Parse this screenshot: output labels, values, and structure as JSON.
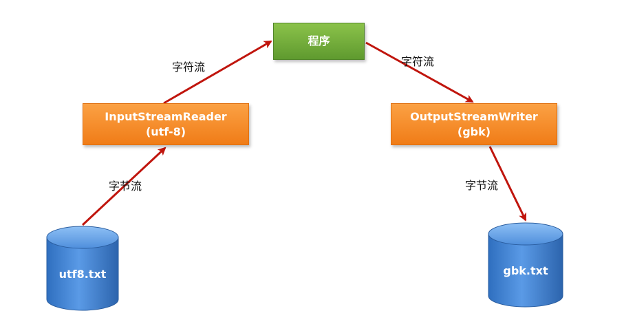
{
  "nodes": {
    "program": {
      "label": "程序"
    },
    "reader": {
      "line1": "InputStreamReader",
      "line2": "(utf-8)"
    },
    "writer": {
      "line1": "OutputStreamWriter",
      "line2": "(gbk)"
    },
    "source_file": {
      "label": "utf8.txt"
    },
    "target_file": {
      "label": "gbk.txt"
    }
  },
  "edges": {
    "reader_to_program": {
      "label": "字符流"
    },
    "program_to_writer": {
      "label": "字符流"
    },
    "file_to_reader": {
      "label": "字节流"
    },
    "writer_to_file": {
      "label": "字节流"
    }
  },
  "colors": {
    "arrow": "#c0150d",
    "program_fill": "#6fae3a",
    "stream_fill": "#f58a22",
    "file_fill": "#3d7fd0"
  }
}
